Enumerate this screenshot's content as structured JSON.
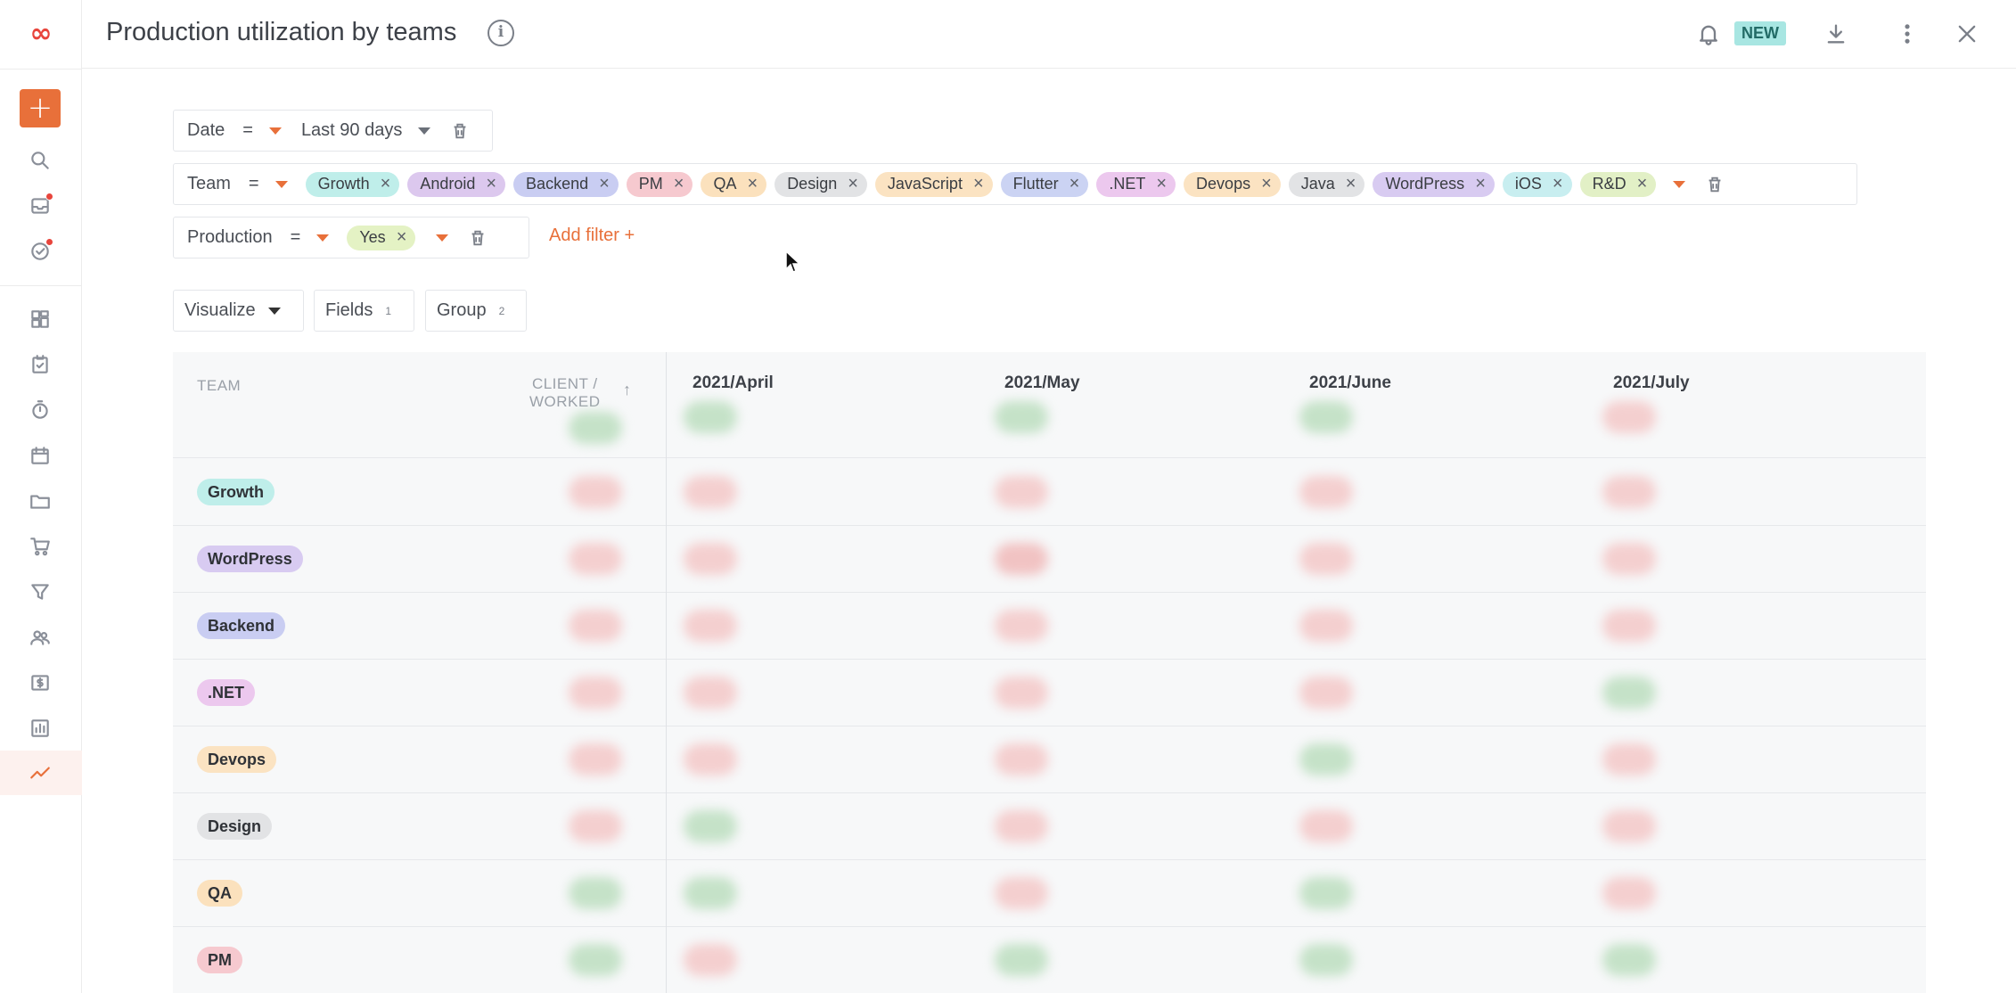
{
  "header": {
    "title": "Production utilization by teams",
    "new_badge": "NEW"
  },
  "sidebar": {
    "logo": "∞",
    "add_label": "+",
    "items": [
      {
        "icon": "search-icon"
      },
      {
        "icon": "inbox-icon",
        "dot": true
      },
      {
        "icon": "check-circle-icon",
        "dot": true
      },
      {
        "icon": "dashboard-icon"
      },
      {
        "icon": "task-icon"
      },
      {
        "icon": "timer-icon"
      },
      {
        "icon": "calendar-icon"
      },
      {
        "icon": "folder-icon"
      },
      {
        "icon": "cart-icon"
      },
      {
        "icon": "filter-icon"
      },
      {
        "icon": "people-icon"
      },
      {
        "icon": "dollar-icon"
      },
      {
        "icon": "report-icon"
      },
      {
        "icon": "trend-icon",
        "active": true
      }
    ]
  },
  "filters": {
    "date": {
      "label": "Date",
      "op": "=",
      "value": "Last 90 days"
    },
    "team": {
      "label": "Team",
      "op": "=",
      "chips": [
        {
          "label": "Growth",
          "color": "#bfeeea"
        },
        {
          "label": "Android",
          "color": "#dcc8ee"
        },
        {
          "label": "Backend",
          "color": "#c9cdf2"
        },
        {
          "label": "PM",
          "color": "#f6c9cf"
        },
        {
          "label": "QA",
          "color": "#fbe1bd"
        },
        {
          "label": "Design",
          "color": "#e2e3e5"
        },
        {
          "label": "JavaScript",
          "color": "#fbe3c2"
        },
        {
          "label": "Flutter",
          "color": "#cbd3f3"
        },
        {
          "label": ".NET",
          "color": "#ecc8ee"
        },
        {
          "label": "Devops",
          "color": "#fbe3c2"
        },
        {
          "label": "Java",
          "color": "#e2e3e5"
        },
        {
          "label": "WordPress",
          "color": "#d8cbf1"
        },
        {
          "label": "iOS",
          "color": "#c8eef0"
        },
        {
          "label": "R&D",
          "color": "#e2f0c6"
        }
      ]
    },
    "production": {
      "label": "Production",
      "op": "=",
      "chips": [
        {
          "label": "Yes",
          "color": "#e4f2c4"
        }
      ]
    },
    "add_filter": "Add filter +"
  },
  "toolbar": {
    "visualize": "Visualize",
    "fields": "Fields",
    "fields_count": "1",
    "group": "Group",
    "group_count": "2"
  },
  "table": {
    "col_team": "TEAM",
    "col_client_line1": "CLIENT /",
    "col_client_line2": "WORKED",
    "months": [
      "2021/April",
      "2021/May",
      "2021/June",
      "2021/July"
    ],
    "rows": [
      {
        "team": "Growth",
        "color": "#bfeeea"
      },
      {
        "team": "WordPress",
        "color": "#d8cbf1"
      },
      {
        "team": "Backend",
        "color": "#c9cdf2"
      },
      {
        "team": ".NET",
        "color": "#ecc8ee"
      },
      {
        "team": "Devops",
        "color": "#fbe3c2"
      },
      {
        "team": "Design",
        "color": "#e2e3e5"
      },
      {
        "team": "QA",
        "color": "#fbe1bd"
      },
      {
        "team": "PM",
        "color": "#f6c9cf"
      }
    ]
  }
}
